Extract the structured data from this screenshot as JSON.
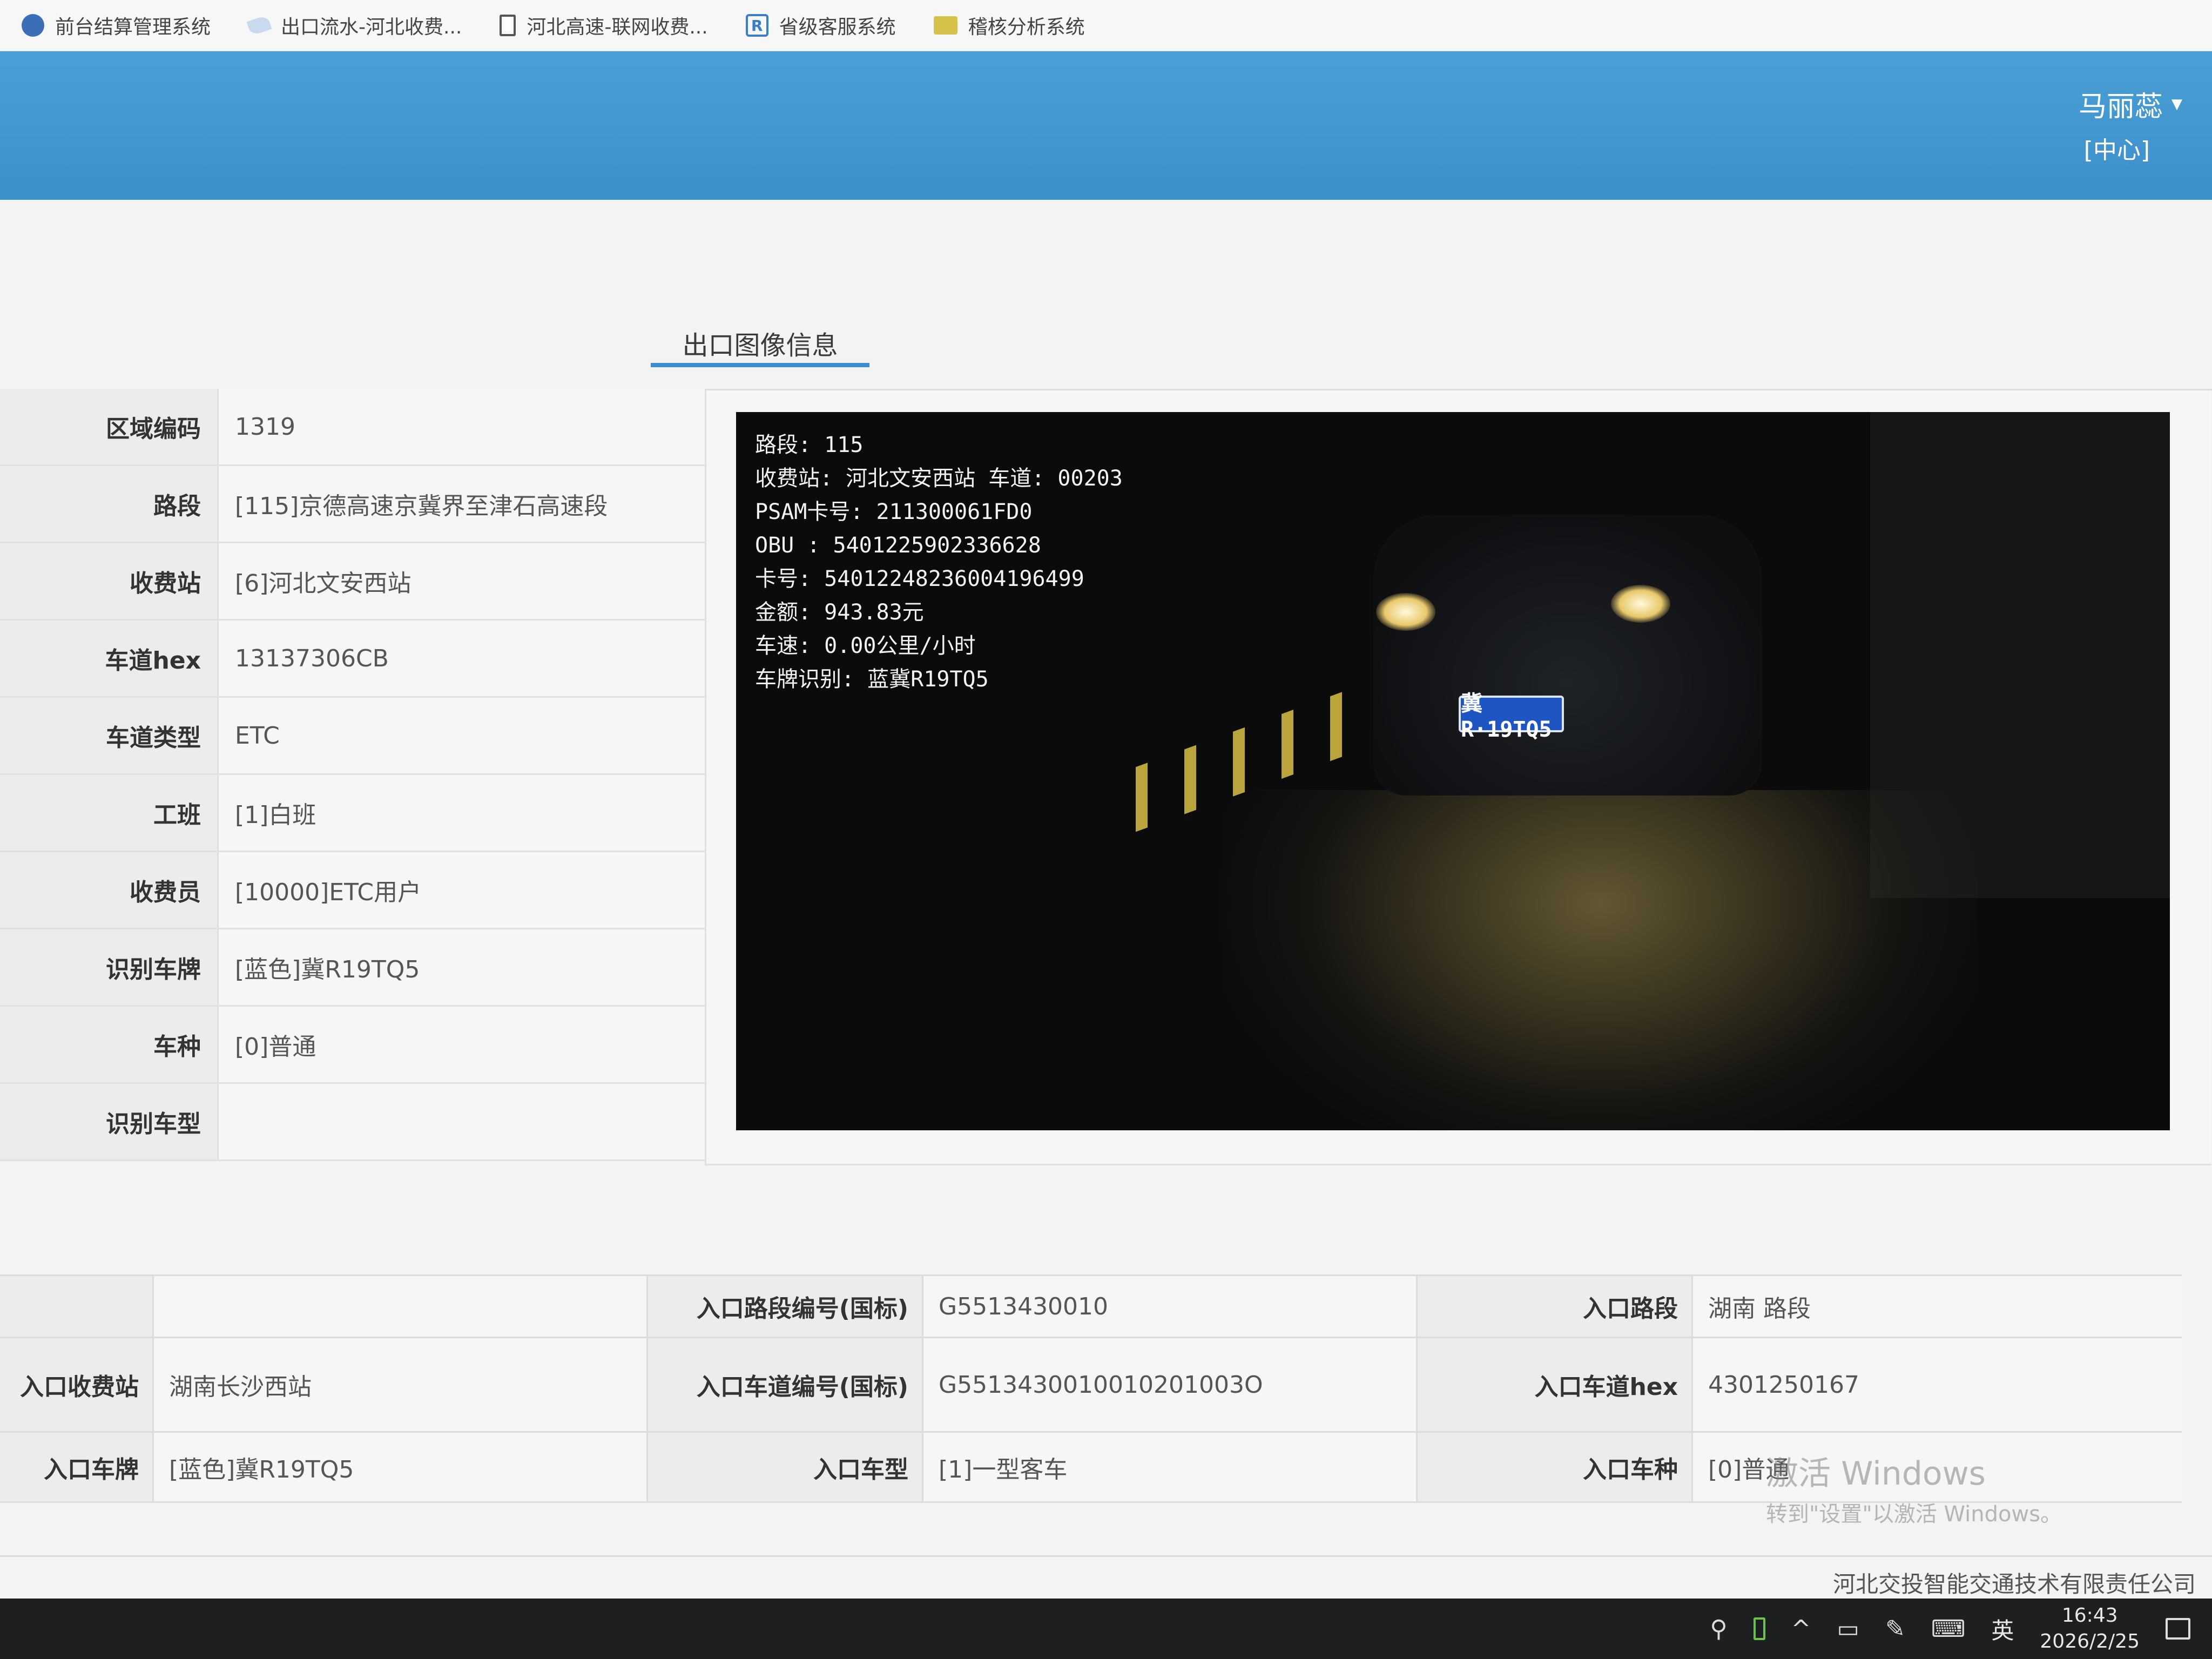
{
  "bookmarks": [
    {
      "label": "前台结算管理系统",
      "icon": "globe-icon"
    },
    {
      "label": "出口流水-河北收费...",
      "icon": "leaf-icon"
    },
    {
      "label": "河北高速-联网收费...",
      "icon": "document-icon"
    },
    {
      "label": "省级客服系统",
      "icon": "r-logo-icon"
    },
    {
      "label": "稽核分析系统",
      "icon": "folder-icon"
    }
  ],
  "header": {
    "user_name": "马丽蕊",
    "user_role": "[中心]",
    "brand_color": "#3d8fca"
  },
  "tab": {
    "title": "出口图像信息"
  },
  "detail": [
    {
      "label": "区域编码",
      "value": "1319"
    },
    {
      "label": "路段",
      "value": "[115]京德高速京冀界至津石高速段"
    },
    {
      "label": "收费站",
      "value": "[6]河北文安西站"
    },
    {
      "label": "车道hex",
      "value": "13137306CB"
    },
    {
      "label": "车道类型",
      "value": "ETC"
    },
    {
      "label": "工班",
      "value": "[1]白班"
    },
    {
      "label": "收费员",
      "value": "[10000]ETC用户"
    },
    {
      "label": "识别车牌",
      "value": "[蓝色]冀R19TQ5"
    },
    {
      "label": "车种",
      "value": "[0]普通"
    },
    {
      "label": "识别车型",
      "value": ""
    }
  ],
  "camera": {
    "overlay_lines": [
      "路段: 115",
      "收费站: 河北文安西站 车道: 00203",
      "PSAM卡号: 211300061FD0",
      "OBU : 5401225902336628",
      "卡号: 54012248236004196499",
      "金额: 943.83元",
      "车速: 0.00公里/小时",
      "车牌识别: 蓝冀R19TQ5"
    ],
    "plate_text": "冀R·19TQ5"
  },
  "entry": {
    "row1": {
      "label_a": "",
      "value_a": "",
      "label_b": "入口路段编号(国标)",
      "value_b": "G5513430010",
      "label_c": "入口路段",
      "value_c": "湖南 路段"
    },
    "row2": {
      "label_a": "入口收费站",
      "value_a": "湖南长沙西站",
      "label_b": "入口车道编号(国标)",
      "value_b": "G5513430010010201003O",
      "label_c": "入口车道hex",
      "value_c": "4301250167"
    },
    "row3": {
      "label_a": "入口车牌",
      "value_a": "[蓝色]冀R19TQ5",
      "label_b": "入口车型",
      "value_b": "[1]一型客车",
      "label_c": "入口车种",
      "value_c": "[0]普通"
    }
  },
  "watermark": {
    "title": "激活 Windows",
    "subtitle": "转到\"设置\"以激活 Windows。"
  },
  "footer": {
    "company": "河北交投智能交通技术有限责任公司"
  },
  "taskbar": {
    "ime": "英",
    "time": "16:43",
    "date": "2026/2/25"
  }
}
